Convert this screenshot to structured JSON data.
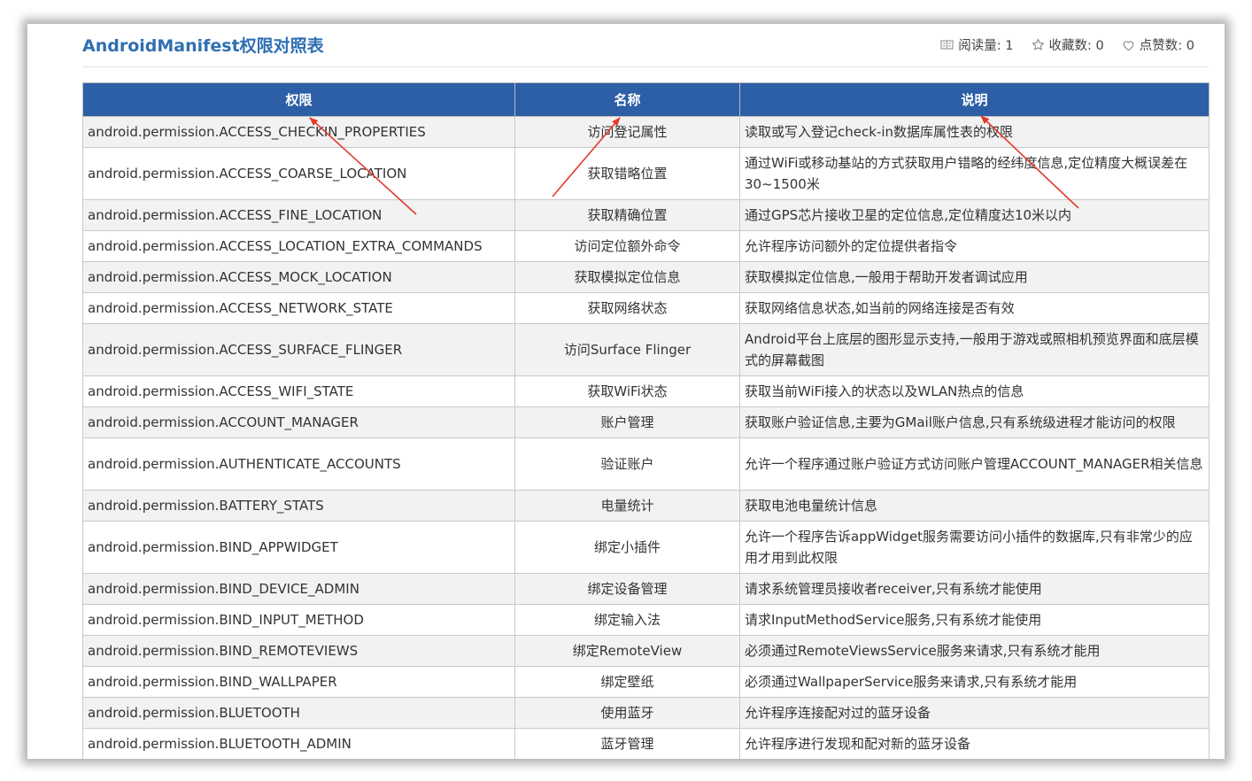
{
  "page": {
    "title": "AndroidManifest权限对照表",
    "stats": [
      {
        "icon": "book-icon",
        "label": "阅读量: 1"
      },
      {
        "icon": "star-icon",
        "label": "收藏数: 0"
      },
      {
        "icon": "heart-icon",
        "label": "点赞数: 0"
      }
    ]
  },
  "table": {
    "headers": [
      "权限",
      "名称",
      "说明"
    ],
    "rows": [
      {
        "perm": "android.permission.ACCESS_CHECKIN_PROPERTIES",
        "name": "访问登记属性",
        "desc": "读取或写入登记check-in数据库属性表的权限"
      },
      {
        "perm": "android.permission.ACCESS_COARSE_LOCATION",
        "name": "获取错略位置",
        "desc": "通过WiFi或移动基站的方式获取用户错略的经纬度信息,定位精度大概误差在30~1500米"
      },
      {
        "perm": "android.permission.ACCESS_FINE_LOCATION",
        "name": "获取精确位置",
        "desc": "通过GPS芯片接收卫星的定位信息,定位精度达10米以内"
      },
      {
        "perm": "android.permission.ACCESS_LOCATION_EXTRA_COMMANDS",
        "name": "访问定位额外命令",
        "desc": "允许程序访问额外的定位提供者指令"
      },
      {
        "perm": "android.permission.ACCESS_MOCK_LOCATION",
        "name": "获取模拟定位信息",
        "desc": "获取模拟定位信息,一般用于帮助开发者调试应用"
      },
      {
        "perm": "android.permission.ACCESS_NETWORK_STATE",
        "name": "获取网络状态",
        "desc": "获取网络信息状态,如当前的网络连接是否有效"
      },
      {
        "perm": "android.permission.ACCESS_SURFACE_FLINGER",
        "name": "访问Surface Flinger",
        "desc": "Android平台上底层的图形显示支持,一般用于游戏或照相机预览界面和底层模式的屏幕截图"
      },
      {
        "perm": "android.permission.ACCESS_WIFI_STATE",
        "name": "获取WiFi状态",
        "desc": "获取当前WiFi接入的状态以及WLAN热点的信息"
      },
      {
        "perm": "android.permission.ACCOUNT_MANAGER",
        "name": "账户管理",
        "desc": "获取账户验证信息,主要为GMail账户信息,只有系统级进程才能访问的权限"
      },
      {
        "perm": "android.permission.AUTHENTICATE_ACCOUNTS",
        "name": "验证账户",
        "desc": "允许一个程序通过账户验证方式访问账户管理ACCOUNT_MANAGER相关信息"
      },
      {
        "perm": "android.permission.BATTERY_STATS",
        "name": "电量统计",
        "desc": "获取电池电量统计信息"
      },
      {
        "perm": "android.permission.BIND_APPWIDGET",
        "name": "绑定小插件",
        "desc": "允许一个程序告诉appWidget服务需要访问小插件的数据库,只有非常少的应用才用到此权限"
      },
      {
        "perm": "android.permission.BIND_DEVICE_ADMIN",
        "name": "绑定设备管理",
        "desc": "请求系统管理员接收者receiver,只有系统才能使用"
      },
      {
        "perm": "android.permission.BIND_INPUT_METHOD",
        "name": "绑定输入法",
        "desc": "请求InputMethodService服务,只有系统才能使用"
      },
      {
        "perm": "android.permission.BIND_REMOTEVIEWS",
        "name": "绑定RemoteView",
        "desc": "必须通过RemoteViewsService服务来请求,只有系统才能用"
      },
      {
        "perm": "android.permission.BIND_WALLPAPER",
        "name": "绑定壁纸",
        "desc": "必须通过WallpaperService服务来请求,只有系统才能用"
      },
      {
        "perm": "android.permission.BLUETOOTH",
        "name": "使用蓝牙",
        "desc": "允许程序连接配对过的蓝牙设备"
      },
      {
        "perm": "android.permission.BLUETOOTH_ADMIN",
        "name": "蓝牙管理",
        "desc": "允许程序进行发现和配对新的蓝牙设备"
      }
    ]
  },
  "annotation": {
    "color": "#e23a2e"
  }
}
